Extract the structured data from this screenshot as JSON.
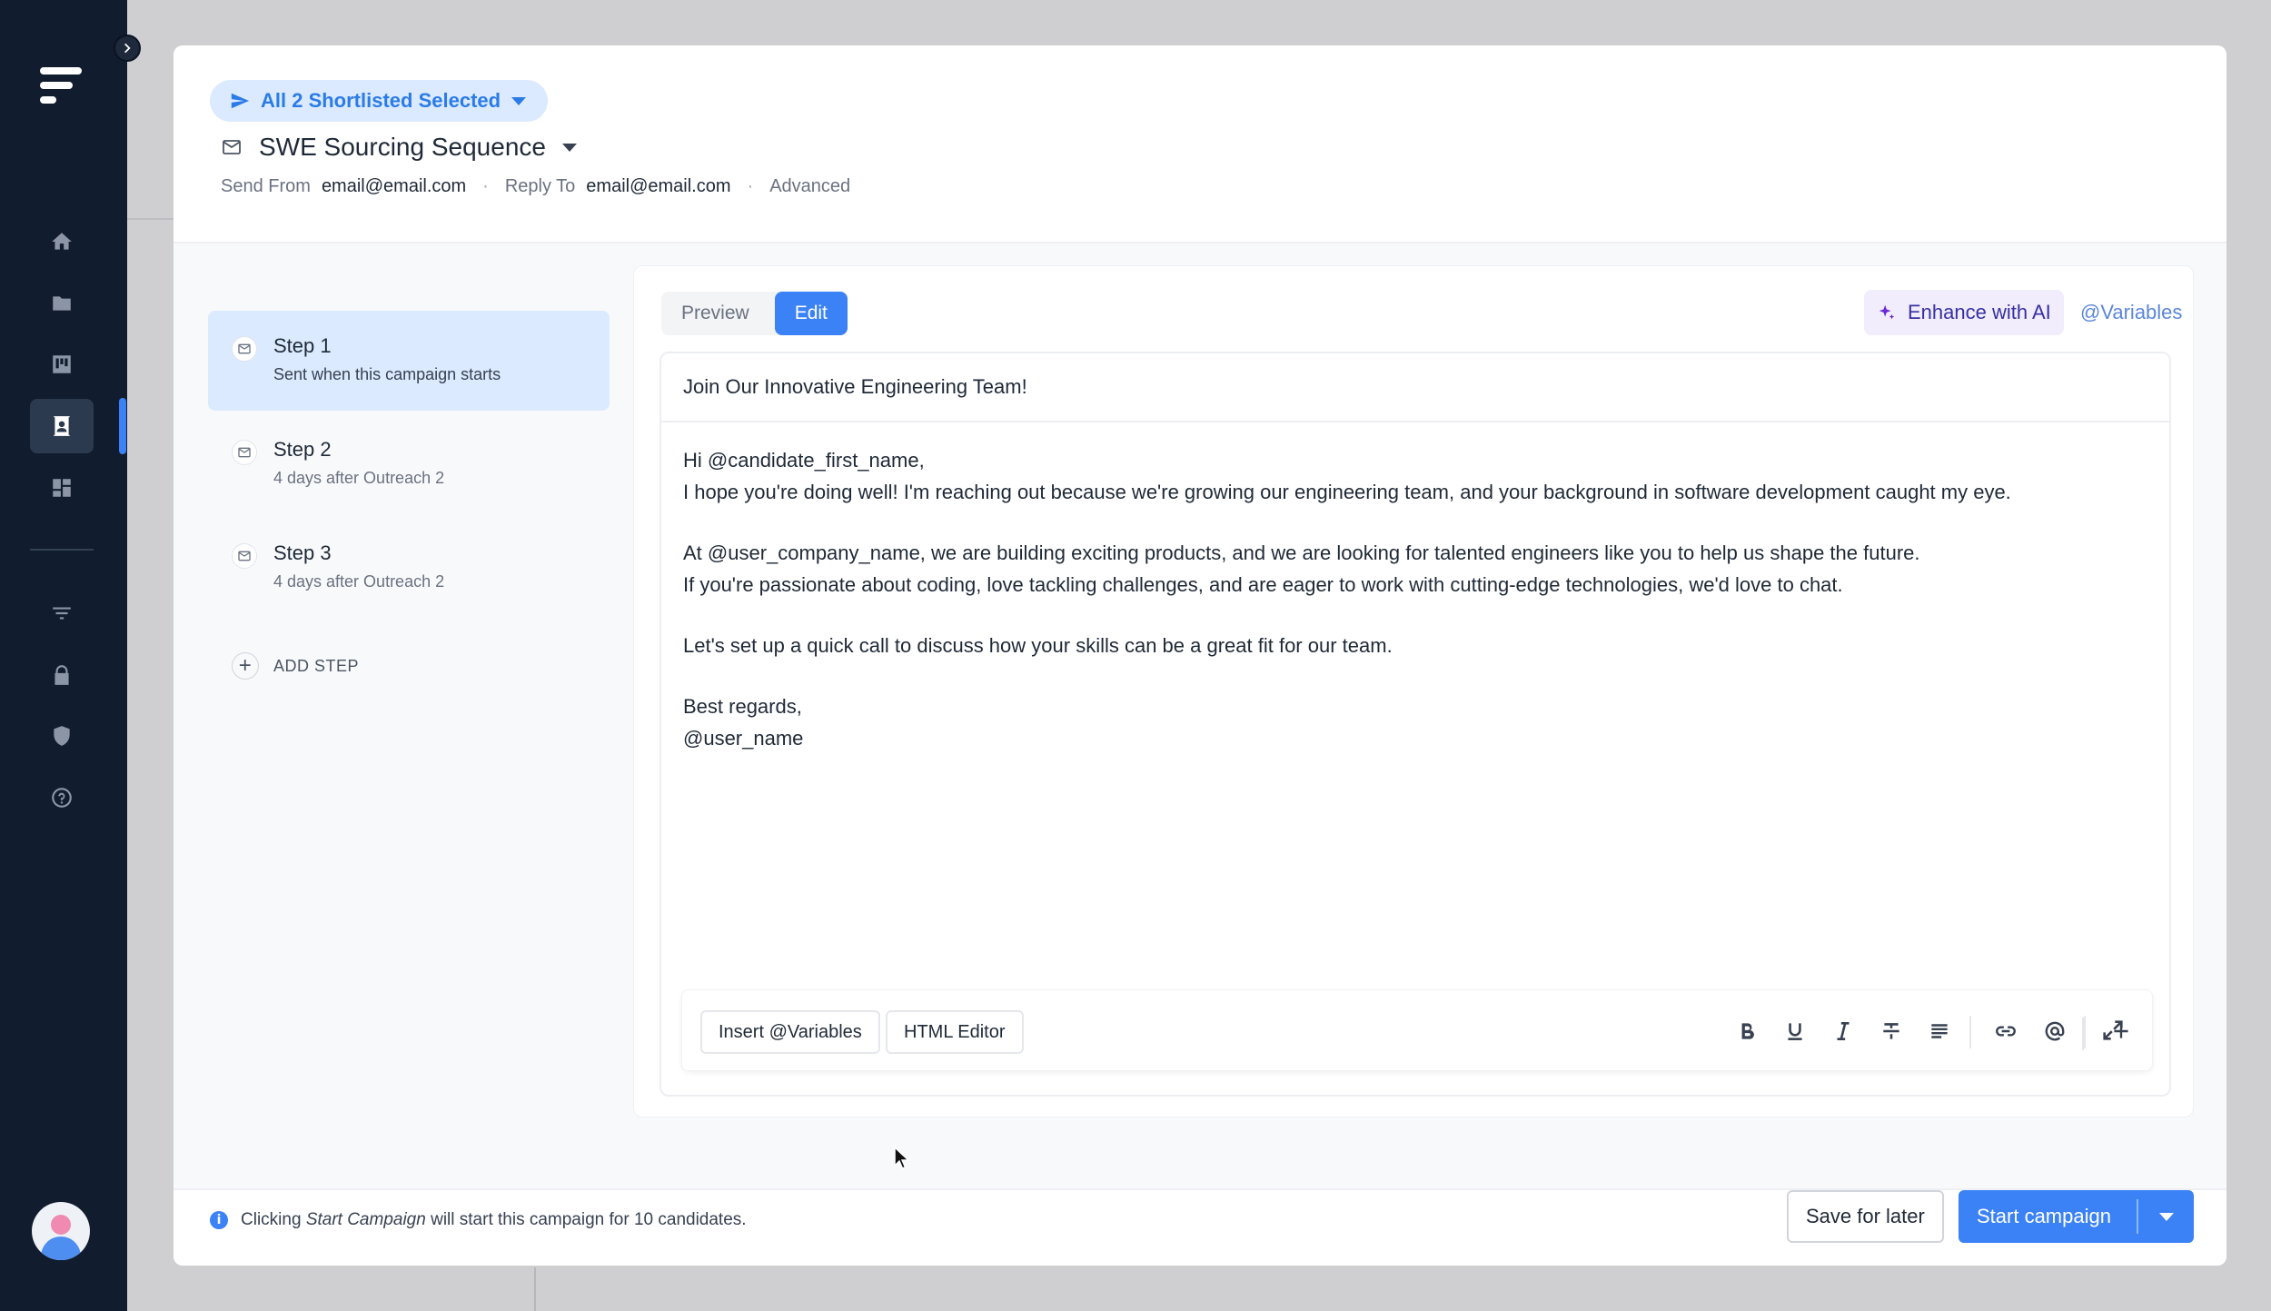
{
  "rail": {
    "nav_icons": [
      "home-icon",
      "folder-icon",
      "board-icon",
      "contacts-icon",
      "dashboard-icon",
      "filter-icon",
      "lock-icon",
      "shield-icon",
      "help-icon"
    ],
    "active_item": "contacts-icon"
  },
  "header": {
    "selection_label": "All 2 Shortlisted Selected",
    "sequence_title": "SWE Sourcing Sequence",
    "send_from_label": "Send From",
    "send_from_value": "email@email.com",
    "reply_to_label": "Reply To",
    "reply_to_value": "email@email.com",
    "advanced_label": "Advanced"
  },
  "steps": [
    {
      "name": "Step 1",
      "sub": "Sent when this campaign starts",
      "active": true
    },
    {
      "name": "Step 2",
      "sub": "4 days after Outreach 2",
      "active": false
    },
    {
      "name": "Step 3",
      "sub": "4 days after Outreach 2",
      "active": false
    }
  ],
  "add_step_label": "ADD STEP",
  "editor": {
    "tabs": [
      {
        "label": "Preview",
        "active": false
      },
      {
        "label": "Edit",
        "active": true
      }
    ],
    "enhance_label": "Enhance with AI",
    "variables_link": "@Variables",
    "subject": "Join Our Innovative Engineering Team!",
    "body": [
      "Hi @candidate_first_name,",
      "I hope you're doing well! I'm reaching out because we're growing our engineering team, and your background in software development caught my eye.",
      "",
      "At @user_company_name, we are building exciting products, and we are looking for talented engineers like you to help us shape the future.",
      "If you're passionate about coding, love tackling challenges, and are eager to work with cutting-edge technologies, we'd love to chat.",
      "",
      "Let's set up a quick call to discuss how your skills can be a great fit for our team.",
      "",
      "Best regards,",
      "@user_name"
    ],
    "insert_variables_label": "Insert @Variables",
    "html_editor_label": "HTML Editor",
    "format_tools": [
      "bold-icon",
      "underline-icon",
      "italic-icon",
      "strikethrough-icon",
      "align-icon",
      "link-icon",
      "mention-icon",
      "plus-icon",
      "expand-icon"
    ]
  },
  "footer": {
    "info_prefix": "Clicking",
    "info_emph": "Start Campaign",
    "info_suffix": "will start this campaign for 10 candidates.",
    "save_label": "Save for later",
    "start_label": "Start campaign"
  },
  "colors": {
    "accent": "#3b82f6",
    "rail": "#111c2e",
    "ai": "#6d28d9"
  }
}
